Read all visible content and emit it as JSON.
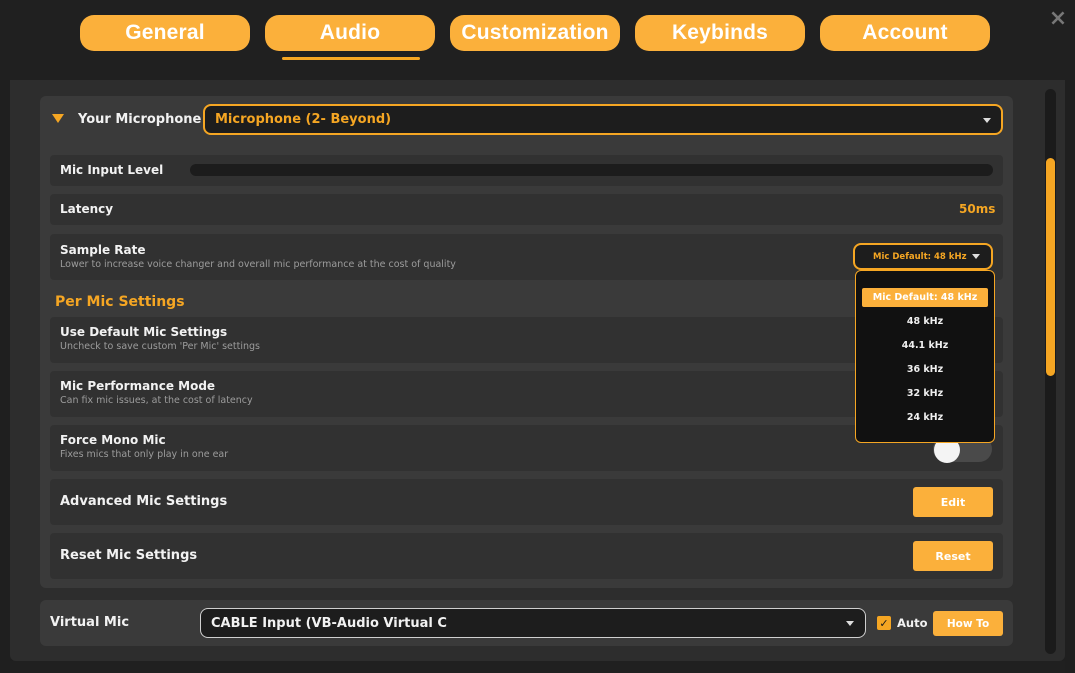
{
  "tabs": [
    {
      "label": "General"
    },
    {
      "label": "Audio"
    },
    {
      "label": "Customization"
    },
    {
      "label": "Keybinds"
    },
    {
      "label": "Account"
    }
  ],
  "active_tab": "Audio",
  "close_icon": "×",
  "microphone": {
    "label": "Your Microphone",
    "selected": "Microphone (2- Beyond)"
  },
  "mic_input_level": {
    "label": "Mic Input Level",
    "level": 0
  },
  "latency": {
    "label": "Latency",
    "value": "50ms"
  },
  "sample_rate": {
    "label": "Sample Rate",
    "description": "Lower to increase voice changer and overall mic performance at the cost of quality",
    "selected": "Mic Default: 48 kHz",
    "options": [
      "Mic Default: 48 kHz",
      "48 kHz",
      "44.1 kHz",
      "36 kHz",
      "32 kHz",
      "24 kHz"
    ]
  },
  "per_mic": {
    "heading": "Per Mic Settings",
    "use_default": {
      "label": "Use Default Mic Settings",
      "description": "Uncheck to save custom 'Per Mic' settings"
    },
    "performance": {
      "label": "Mic Performance Mode",
      "description": "Can fix mic issues, at the cost of latency"
    },
    "mono": {
      "label": "Force Mono Mic",
      "description": "Fixes mics that only play in one ear",
      "enabled": false
    }
  },
  "advanced": {
    "label": "Advanced Mic Settings",
    "button": "Edit"
  },
  "reset": {
    "label": "Reset Mic Settings",
    "button": "Reset"
  },
  "virtual_mic": {
    "label": "Virtual Mic",
    "selected": "CABLE Input (VB-Audio Virtual C",
    "auto_label": "Auto",
    "auto_checked": true,
    "howto_button": "How To"
  },
  "colors": {
    "accent": "#f5a623",
    "tab": "#fbb03b",
    "background": "#1f1f1f",
    "panel": "#2d2d2d"
  }
}
